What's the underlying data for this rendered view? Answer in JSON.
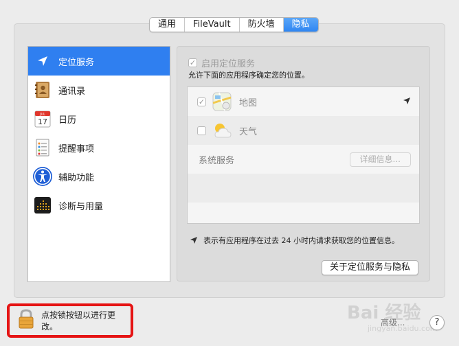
{
  "tabs": [
    {
      "label": "通用",
      "active": false
    },
    {
      "label": "FileVault",
      "active": false
    },
    {
      "label": "防火墙",
      "active": false
    },
    {
      "label": "隐私",
      "active": true
    }
  ],
  "sidebar": {
    "items": [
      {
        "label": "定位服务",
        "icon": "location-arrow-icon",
        "selected": true
      },
      {
        "label": "通讯录",
        "icon": "contacts-book-icon",
        "selected": false
      },
      {
        "label": "日历",
        "icon": "calendar-icon",
        "selected": false,
        "icon_month": "JUL",
        "icon_day": "17"
      },
      {
        "label": "提醒事项",
        "icon": "reminders-icon",
        "selected": false
      },
      {
        "label": "辅助功能",
        "icon": "accessibility-icon",
        "selected": false
      },
      {
        "label": "诊断与用量",
        "icon": "diagnostics-icon",
        "selected": false
      }
    ]
  },
  "location": {
    "enable_label": "启用定位服务",
    "enable_checked": true,
    "description": "允许下面的应用程序确定您的位置。",
    "apps": [
      {
        "name": "地图",
        "checked": true,
        "icon": "maps-icon",
        "recent_use": true
      },
      {
        "name": "天气",
        "checked": false,
        "icon": "weather-icon",
        "recent_use": false
      }
    ],
    "system_services_label": "系统服务",
    "details_button": "详细信息...",
    "legend_text": "表示有应用程序在过去 24 小时内请求获取您的位置信息。",
    "about_button": "关于定位服务与隐私"
  },
  "footer": {
    "lock_label": "点按锁按钮以进行更改。",
    "advanced_button": "高级...",
    "help_button": "?"
  },
  "watermark": {
    "text": "Bai 经验",
    "sub": "jingyan.baidu.com"
  },
  "colors": {
    "accent": "#2f7ff0",
    "highlight_border": "#e51414"
  }
}
